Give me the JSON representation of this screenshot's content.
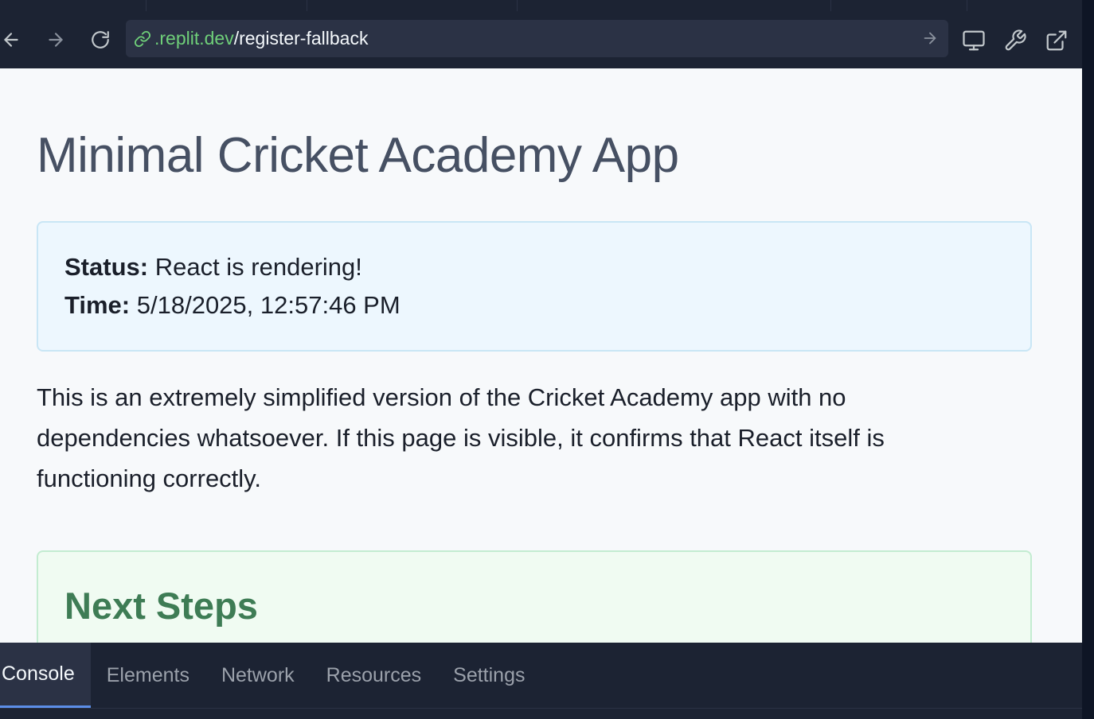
{
  "browser": {
    "url_host": ".replit.dev",
    "url_path": "/register-fallback",
    "back_icon": "arrow-left-icon",
    "forward_icon": "arrow-right-icon",
    "reload_icon": "reload-icon",
    "tools": [
      "monitor-icon",
      "wrench-icon",
      "external-link-icon"
    ]
  },
  "page": {
    "title": "Minimal Cricket Academy App",
    "status_label": "Status:",
    "status_value": "React is rendering!",
    "time_label": "Time:",
    "time_value": "5/18/2025, 12:57:46 PM",
    "description": "This is an extremely simplified version of the Cricket Academy app with no dependencies whatsoever. If this page is visible, it confirms that React itself is functioning correctly.",
    "next_steps_title": "Next Steps"
  },
  "devtools": {
    "tabs": [
      "Console",
      "Elements",
      "Network",
      "Resources",
      "Settings"
    ],
    "active_tab": "Console"
  },
  "colors": {
    "accent_green": "#6fcf79",
    "active_tab_underline": "#5c8ee8",
    "status_bg": "#edf7fe",
    "next_steps_bg": "#f0fbf2"
  }
}
